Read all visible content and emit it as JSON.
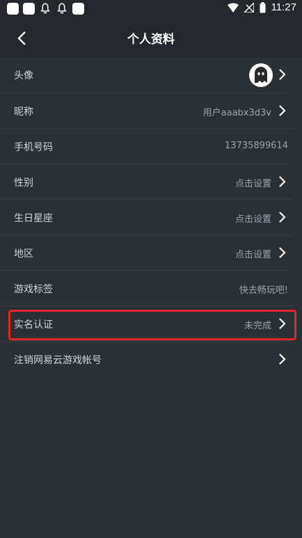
{
  "status_bar": {
    "time": "11:27"
  },
  "header": {
    "title": "个人资料",
    "back_icon": "chevron-left-icon"
  },
  "profile": {
    "avatar": {
      "label": "头像"
    },
    "nickname": {
      "label": "昵称",
      "value": "用户aaabx3d3v"
    },
    "phone": {
      "label": "手机号码",
      "value": "13735899614"
    },
    "gender": {
      "label": "性别",
      "value": "点击设置"
    },
    "birthday": {
      "label": "生日星座",
      "value": "点击设置"
    },
    "region": {
      "label": "地区",
      "value": "点击设置"
    },
    "game_tags": {
      "label": "游戏标签",
      "value": "快去畅玩吧!"
    },
    "real_name": {
      "label": "实名认证",
      "value": "未完成"
    },
    "cancel_account": {
      "label": "注销网易云游戏帐号"
    }
  },
  "colors": {
    "background": "#2b3035",
    "header": "#24282c",
    "highlight": "#e0262a"
  }
}
